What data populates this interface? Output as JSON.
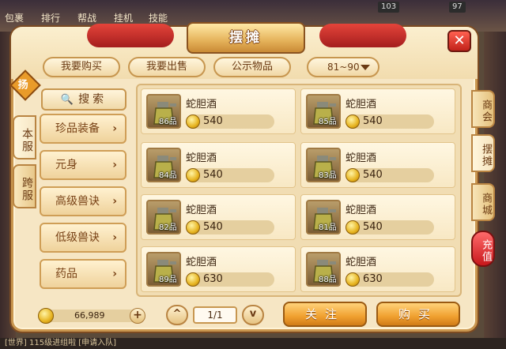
{
  "hud": {
    "left_tabs": [
      "包裹",
      "排行",
      "帮战",
      "挂机",
      "技能"
    ],
    "counter1": "103",
    "counter2": "97",
    "bottom_text": "[世界] 115级进组啦  [申请入队]"
  },
  "window": {
    "title": "摆摊",
    "close_label": "✕"
  },
  "top_tabs": [
    "我要购买",
    "我要出售",
    "公示物品"
  ],
  "level_range": "81~90",
  "server_tabs": {
    "badge": "扬",
    "local": "本服",
    "cross": "跨服"
  },
  "search_label": "搜索",
  "categories": [
    {
      "label": "珍品装备"
    },
    {
      "label": "元身"
    },
    {
      "label": "高级兽诀"
    },
    {
      "label": "低级兽诀"
    },
    {
      "label": "药品"
    }
  ],
  "items": [
    {
      "name": "蛇胆酒",
      "grade": "86品",
      "price": "540"
    },
    {
      "name": "蛇胆酒",
      "grade": "85品",
      "price": "540"
    },
    {
      "name": "蛇胆酒",
      "grade": "84品",
      "price": "540"
    },
    {
      "name": "蛇胆酒",
      "grade": "83品",
      "price": "540"
    },
    {
      "name": "蛇胆酒",
      "grade": "82品",
      "price": "540"
    },
    {
      "name": "蛇胆酒",
      "grade": "81品",
      "price": "540"
    },
    {
      "name": "蛇胆酒",
      "grade": "89品",
      "price": "630"
    },
    {
      "name": "蛇胆酒",
      "grade": "88品",
      "price": "630"
    }
  ],
  "money": "66,989",
  "pagination": {
    "page": "1/1",
    "prev_icon": "^",
    "next_icon": "v"
  },
  "buttons": {
    "follow": "关注",
    "buy": "购买"
  },
  "right_tabs": [
    "商会",
    "摆摊",
    "商城",
    "充值"
  ],
  "colors": {
    "accent": "#e99b2a",
    "panel_bg": "#f6e6c4",
    "action": "#f0a030",
    "recharge": "#c8181c"
  }
}
